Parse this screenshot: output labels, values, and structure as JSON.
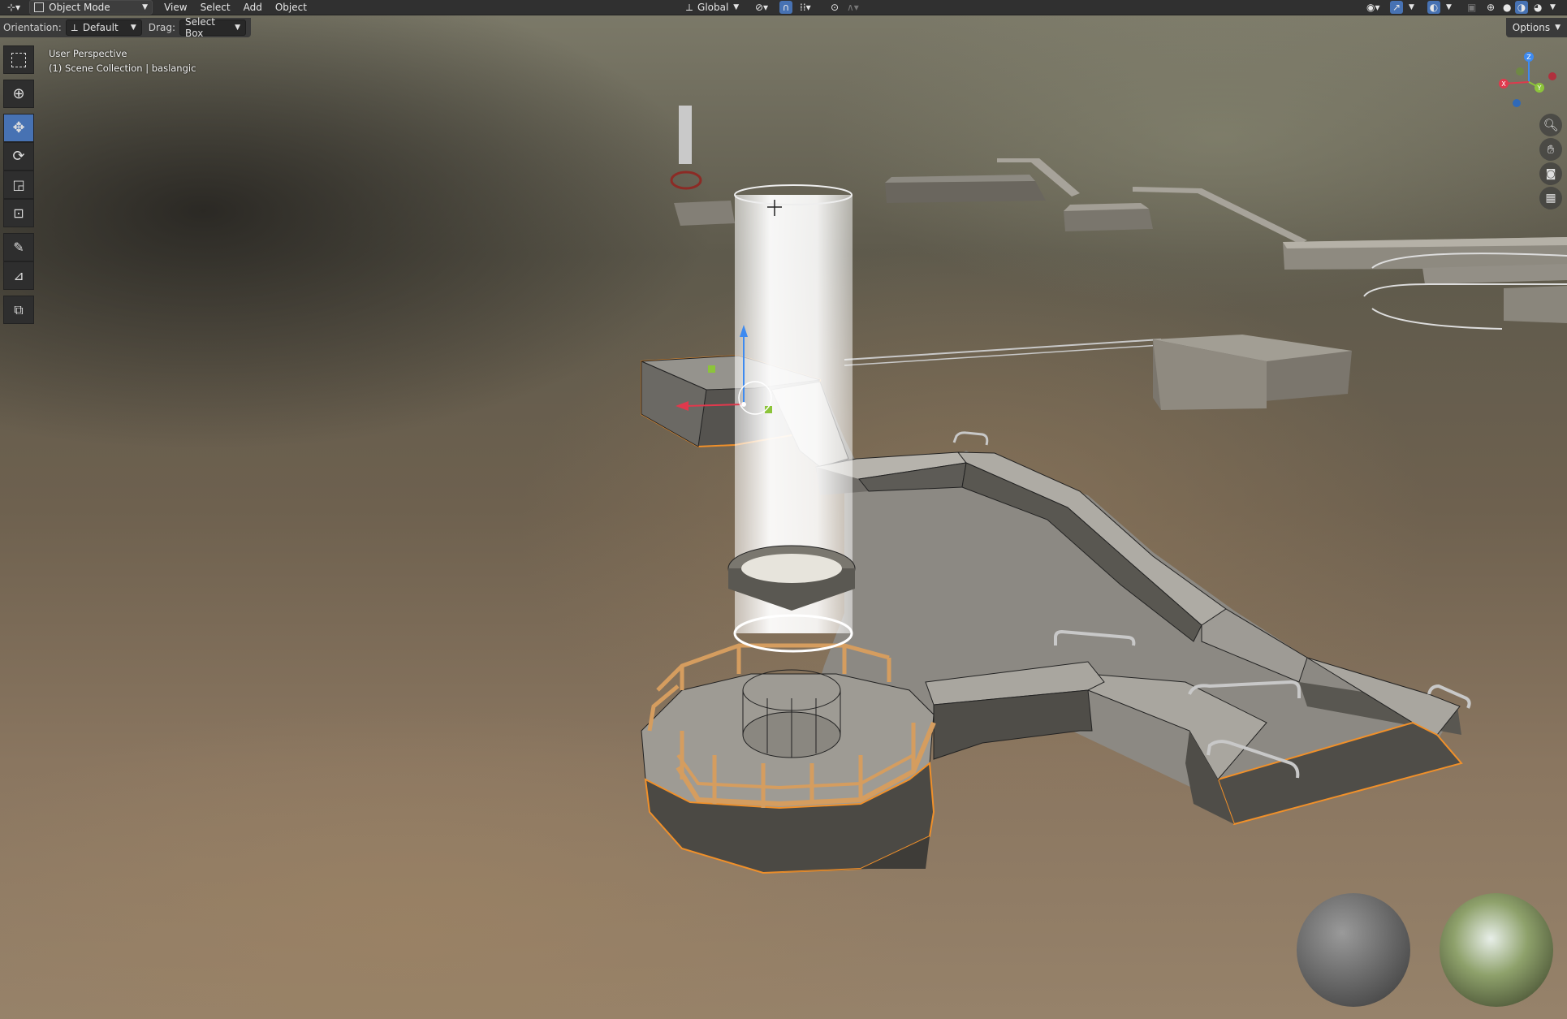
{
  "header": {
    "mode_label": "Object Mode",
    "menus": [
      "View",
      "Select",
      "Add",
      "Object"
    ],
    "transform_orientation": "Global"
  },
  "tool_settings": {
    "orientation_label": "Orientation:",
    "orientation_value": "Default",
    "drag_label": "Drag:",
    "drag_value": "Select Box",
    "options_label": "Options"
  },
  "viewport": {
    "view_name": "User Perspective",
    "collection_info": "(1) Scene Collection | baslangic"
  },
  "toolbar": {
    "tools": [
      "select-box",
      "cursor",
      "move",
      "rotate",
      "scale",
      "transform",
      "annotate",
      "measure",
      "add-cube"
    ],
    "active_tool": "move"
  },
  "gizmo": {
    "axes": [
      "X",
      "Y",
      "Z"
    ]
  },
  "colors": {
    "accent": "#4772b3",
    "selection_outline": "#f0902a",
    "x_axis": "#e0394d",
    "y_axis": "#8cc43a",
    "z_axis": "#3d8af0"
  }
}
